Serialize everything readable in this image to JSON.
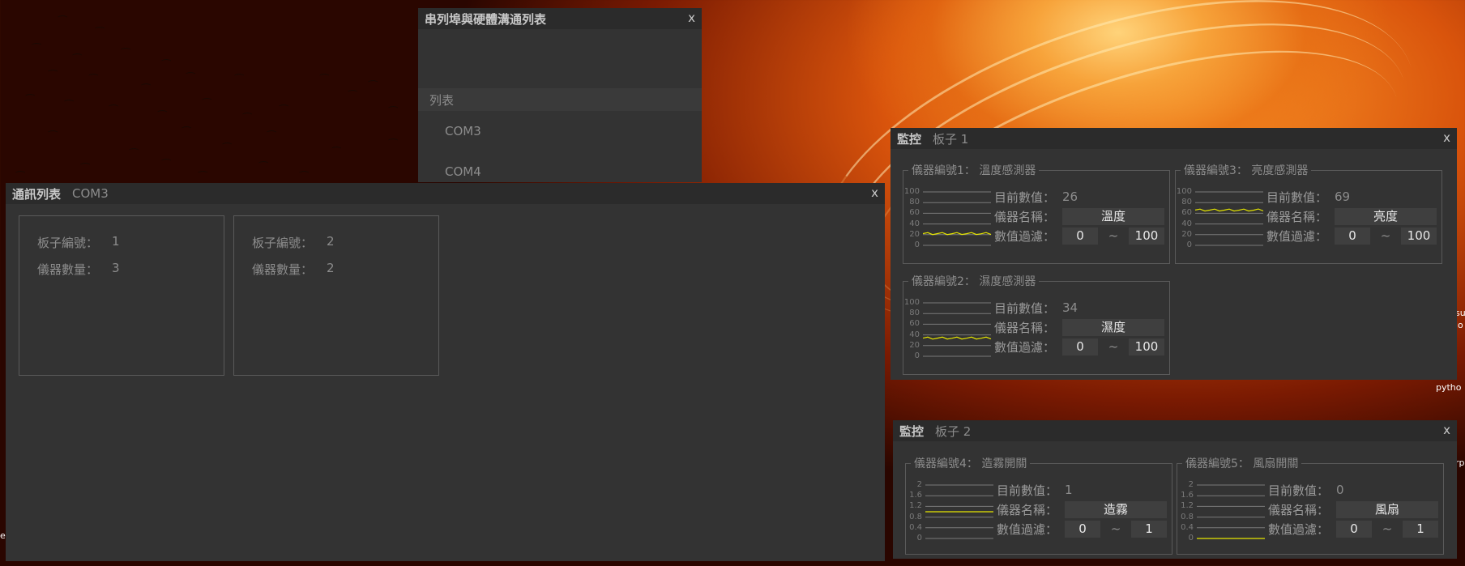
{
  "desktop": {
    "labels": [
      "su",
      "io",
      "pytho",
      "rp",
      "es"
    ]
  },
  "serial_window": {
    "title": "串列埠與硬體溝通列表",
    "close_label": "x",
    "list_header": "列表",
    "ports": [
      "COM3",
      "COM4"
    ]
  },
  "comm_window": {
    "title": "通訊列表",
    "port": "COM3",
    "close_label": "x",
    "boards": [
      {
        "id_label": "板子編號：",
        "id": "1",
        "count_label": "儀器數量：",
        "count": "3"
      },
      {
        "id_label": "板子編號：",
        "id": "2",
        "count_label": "儀器數量：",
        "count": "2"
      }
    ]
  },
  "monitor1": {
    "title": "監控",
    "board": "板子 1",
    "close_label": "x",
    "instruments": [
      {
        "legend": "儀器編號1： 溫度感測器",
        "current_label": "目前數值：",
        "current": "26",
        "name_label": "儀器名稱：",
        "name": "溫度",
        "filter_label": "數值過濾：",
        "min": "0",
        "tilde": "~",
        "max": "100",
        "ticks": [
          "100",
          "80",
          "60",
          "40",
          "20",
          "0"
        ],
        "trace_level": 0.22
      },
      {
        "legend": "儀器編號3： 亮度感測器",
        "current_label": "目前數值：",
        "current": "69",
        "name_label": "儀器名稱：",
        "name": "亮度",
        "filter_label": "數值過濾：",
        "min": "0",
        "tilde": "~",
        "max": "100",
        "ticks": [
          "100",
          "80",
          "60",
          "40",
          "20",
          "0"
        ],
        "trace_level": 0.66
      },
      {
        "legend": "儀器編號2： 濕度感測器",
        "current_label": "目前數值：",
        "current": "34",
        "name_label": "儀器名稱：",
        "name": "濕度",
        "filter_label": "數值過濾：",
        "min": "0",
        "tilde": "~",
        "max": "100",
        "ticks": [
          "100",
          "80",
          "60",
          "40",
          "20",
          "0"
        ],
        "trace_level": 0.34
      }
    ]
  },
  "monitor2": {
    "title": "監控",
    "board": "板子 2",
    "close_label": "x",
    "instruments": [
      {
        "legend": "儀器編號4： 造霧開關",
        "current_label": "目前數值：",
        "current": "1",
        "name_label": "儀器名稱：",
        "name": "造霧",
        "filter_label": "數值過濾：",
        "min": "0",
        "tilde": "~",
        "max": "1",
        "ticks": [
          "2",
          "1.6",
          "1.2",
          "0.8",
          "0.4",
          "0"
        ],
        "trace_level": 0.5
      },
      {
        "legend": "儀器編號5： 風扇開關",
        "current_label": "目前數值：",
        "current": "0",
        "name_label": "儀器名稱：",
        "name": "風扇",
        "filter_label": "數值過濾：",
        "min": "0",
        "tilde": "~",
        "max": "1",
        "ticks": [
          "2",
          "1.6",
          "1.2",
          "0.8",
          "0.4",
          "0"
        ],
        "trace_level": 0.0
      }
    ]
  },
  "colors": {
    "trace": "#e6e600",
    "window_bg": "#333333",
    "titlebar_bg": "#2b2b2b"
  }
}
